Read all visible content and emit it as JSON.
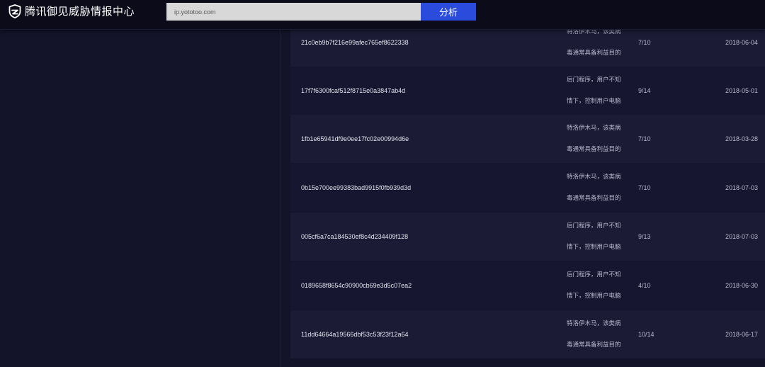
{
  "header": {
    "title": "腾讯御见威胁情报中心",
    "logo_icon": "shield-logo-icon",
    "search_value": "ip.yototoo.com",
    "analyze_label": "分析"
  },
  "colors": {
    "header_bg": "#0b0b19",
    "page_bg": "#131329",
    "button_bg": "#2a4bdc",
    "row_odd": "#1b1b36",
    "row_even": "#161630"
  },
  "table": {
    "rows": [
      {
        "hash": "21c0eb9b7f216e99afec765ef8622338",
        "desc_line1": "特洛伊木马，该类病",
        "desc_line2": "毒通常具备利益目的",
        "ratio": "7/10",
        "date": "2018-06-04"
      },
      {
        "hash": "17f7f6300fcaf512f8715e0a3847ab4d",
        "desc_line1": "后门程序，用户不知",
        "desc_line2": "情下，控制用户电脑",
        "ratio": "9/14",
        "date": "2018-05-01"
      },
      {
        "hash": "1fb1e65941df9e0ee17fc02e00994d6e",
        "desc_line1": "特洛伊木马，该类病",
        "desc_line2": "毒通常具备利益目的",
        "ratio": "7/10",
        "date": "2018-03-28"
      },
      {
        "hash": "0b15e700ee99383bad9915f0fb939d3d",
        "desc_line1": "特洛伊木马，该类病",
        "desc_line2": "毒通常具备利益目的",
        "ratio": "7/10",
        "date": "2018-07-03"
      },
      {
        "hash": "005cf6a7ca184530ef8c4d234409f128",
        "desc_line1": "后门程序，用户不知",
        "desc_line2": "情下，控制用户电脑",
        "ratio": "9/13",
        "date": "2018-07-03"
      },
      {
        "hash": "0189658f8654c90900cb69e3d5c07ea2",
        "desc_line1": "后门程序，用户不知",
        "desc_line2": "情下，控制用户电脑",
        "ratio": "4/10",
        "date": "2018-06-30"
      },
      {
        "hash": "11dd64664a19566dbf53c53f23f12a64",
        "desc_line1": "特洛伊木马，该类病",
        "desc_line2": "毒通常具备利益目的",
        "ratio": "10/14",
        "date": "2018-06-17"
      }
    ]
  }
}
